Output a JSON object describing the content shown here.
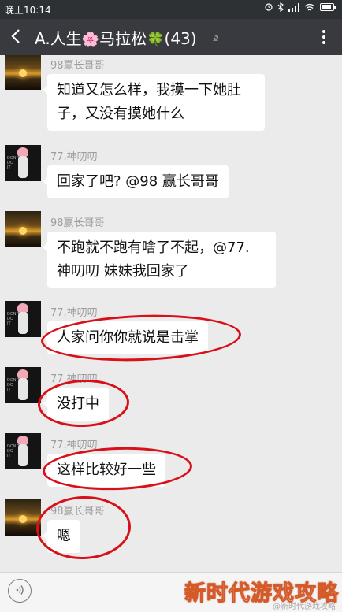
{
  "status": {
    "time": "晚上10:14"
  },
  "header": {
    "title_part1": "A.人生",
    "flower_icon": "🌸",
    "title_part2": "马拉松",
    "clover_icon": "🍀",
    "count": "(43)"
  },
  "messages": [
    {
      "sender": "98赢长哥哥",
      "text1": "知道又怎么样，我摸一下她肚",
      "text2": "子，又没有摸她什么",
      "avatar": "sunset"
    },
    {
      "sender": "77.神叨叨",
      "text1": "回家了吧? @98 赢长哥哥",
      "avatar": "girl"
    },
    {
      "sender": "98赢长哥哥",
      "text1": "不跑就不跑有啥了不起，@77.",
      "text2": "神叨叨  妹妹我回家了",
      "avatar": "sunset"
    },
    {
      "sender": "77.神叨叨",
      "text1": "人家问你你就说是击掌",
      "avatar": "girl"
    },
    {
      "sender": "77.神叨叨",
      "text1": "没打中",
      "avatar": "girl"
    },
    {
      "sender": "77.神叨叨",
      "text1": "这样比较好一些",
      "avatar": "girl"
    },
    {
      "sender": "98赢长哥哥",
      "text1": "嗯",
      "avatar": "sunset"
    }
  ],
  "watermark": {
    "title": "新时代游戏攻略",
    "sub": "@新时代游戏攻略"
  },
  "colors": {
    "header": "#393a3f",
    "annotation": "#d8101a",
    "chat_bg": "#ebebeb"
  }
}
